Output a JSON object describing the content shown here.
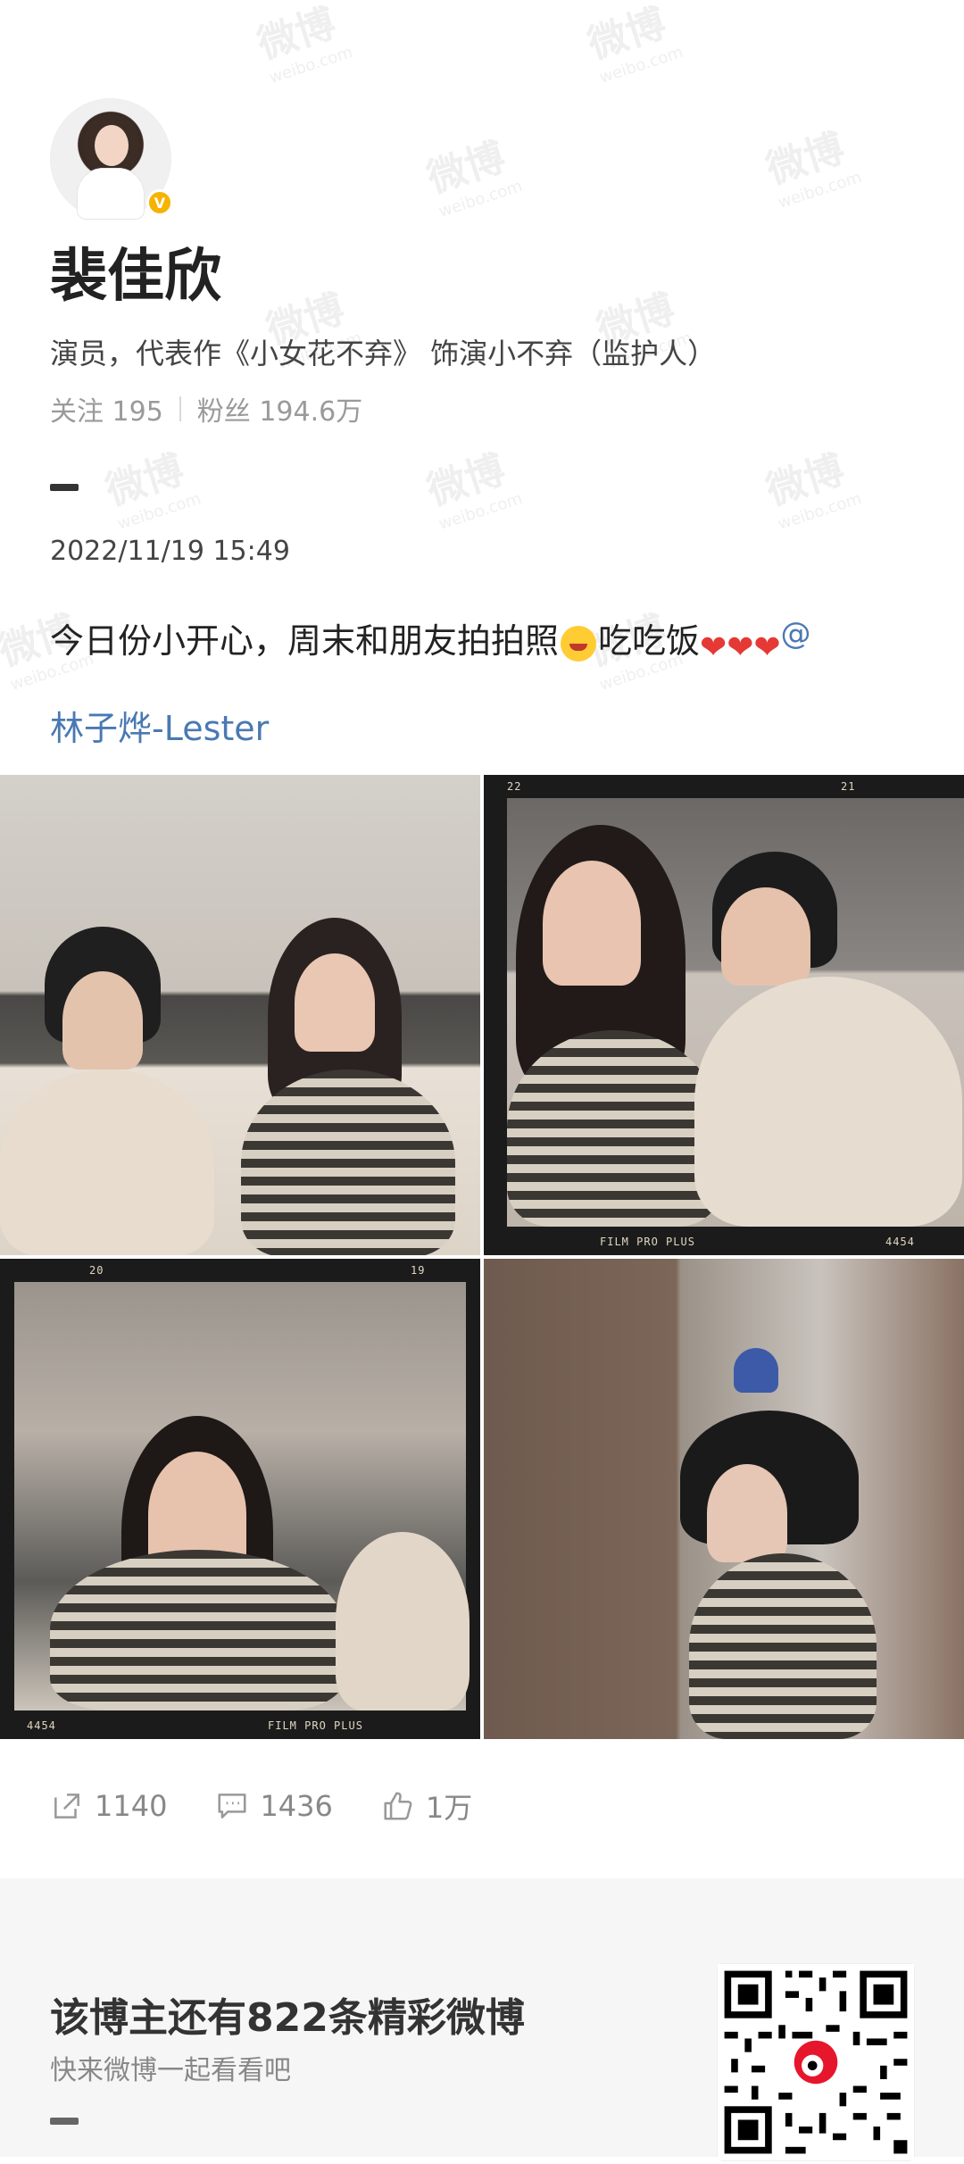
{
  "profile": {
    "name": "裴佳欣",
    "verified_badge_letter": "V",
    "bio": "演员，代表作《小女花不弃》 饰演小不弃（监护人）",
    "following": "关注 195",
    "followers": "粉丝 194.6万"
  },
  "post": {
    "timestamp": "2022/11/19 15:49",
    "text_part1": "今日份小开心，周末和朋友拍拍照",
    "text_part2": "吃吃饭",
    "hearts": "❤❤❤",
    "at": "@",
    "mention": "林子烨-Lester",
    "images": [
      {
        "film_top_left": "",
        "film_top_right": "",
        "film_bottom_left": "",
        "film_bottom_right": ""
      },
      {
        "film_top_left": "22",
        "film_top_right": "21",
        "film_bottom_left": "FILM PRO PLUS",
        "film_bottom_right": "4454"
      },
      {
        "film_top_left": "20",
        "film_top_right": "19",
        "film_bottom_left": "4454",
        "film_bottom_right": "FILM PRO PLUS"
      },
      {
        "film_top_left": "",
        "film_top_right": "",
        "film_bottom_left": "",
        "film_bottom_right": ""
      }
    ]
  },
  "actions": {
    "repost_count": "1140",
    "comment_count": "1436",
    "like_count": "1万",
    "repost_icon": "share-icon",
    "comment_icon": "comment-icon",
    "like_icon": "thumb-up-icon"
  },
  "promo": {
    "title": "该博主还有822条精彩微博",
    "subtitle": "快来微博一起看看吧"
  },
  "watermark": {
    "main": "微博",
    "sub": "weibo.com"
  },
  "colors": {
    "mention": "#4a79b2",
    "heart": "#e53935",
    "verified": "#f6b400"
  }
}
